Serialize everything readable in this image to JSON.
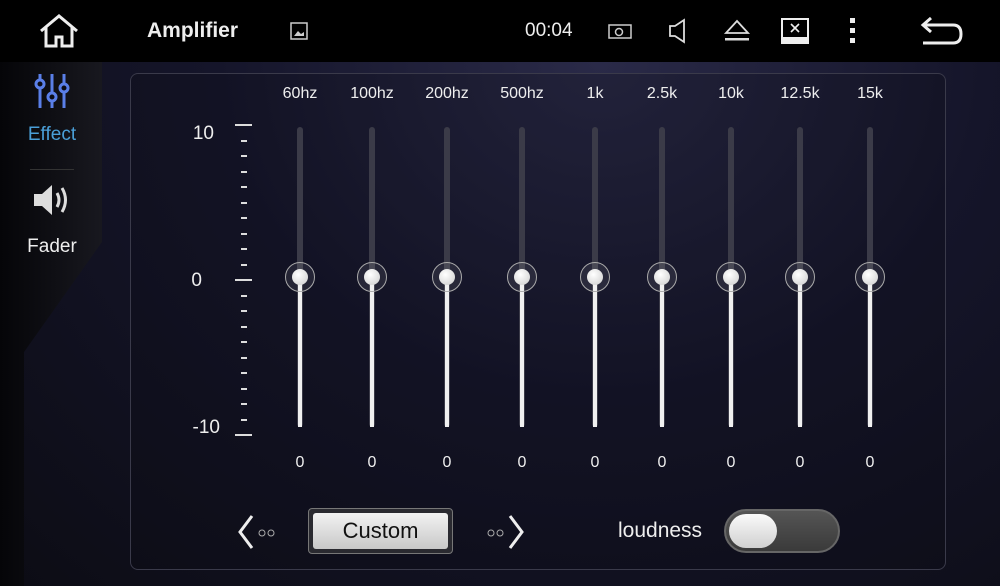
{
  "topbar": {
    "title": "Amplifier",
    "clock": "00:04",
    "icons": [
      "home-icon",
      "image-icon",
      "screenshot-icon",
      "volume-icon",
      "eject-icon",
      "screen-off-icon",
      "more-icon",
      "back-icon"
    ]
  },
  "sidebar": {
    "items": [
      {
        "label": "Effect",
        "icon": "equalizer-icon",
        "active": true,
        "color": "#4a9fd8"
      },
      {
        "label": "Fader",
        "icon": "speaker-icon",
        "active": false
      }
    ]
  },
  "eq": {
    "scale": {
      "max": "10",
      "mid": "0",
      "min": "-10"
    },
    "range": [
      -10,
      10
    ],
    "bands": [
      {
        "label": "60hz",
        "value": 0,
        "display": "0"
      },
      {
        "label": "100hz",
        "value": 0,
        "display": "0"
      },
      {
        "label": "200hz",
        "value": 0,
        "display": "0"
      },
      {
        "label": "500hz",
        "value": 0,
        "display": "0"
      },
      {
        "label": "1k",
        "value": 0,
        "display": "0"
      },
      {
        "label": "2.5k",
        "value": 0,
        "display": "0"
      },
      {
        "label": "10k",
        "value": 0,
        "display": "0"
      },
      {
        "label": "12.5k",
        "value": 0,
        "display": "0"
      },
      {
        "label": "15k",
        "value": 0,
        "display": "0"
      }
    ]
  },
  "controls": {
    "preset": "Custom",
    "loudness_label": "loudness",
    "loudness_on": false
  }
}
